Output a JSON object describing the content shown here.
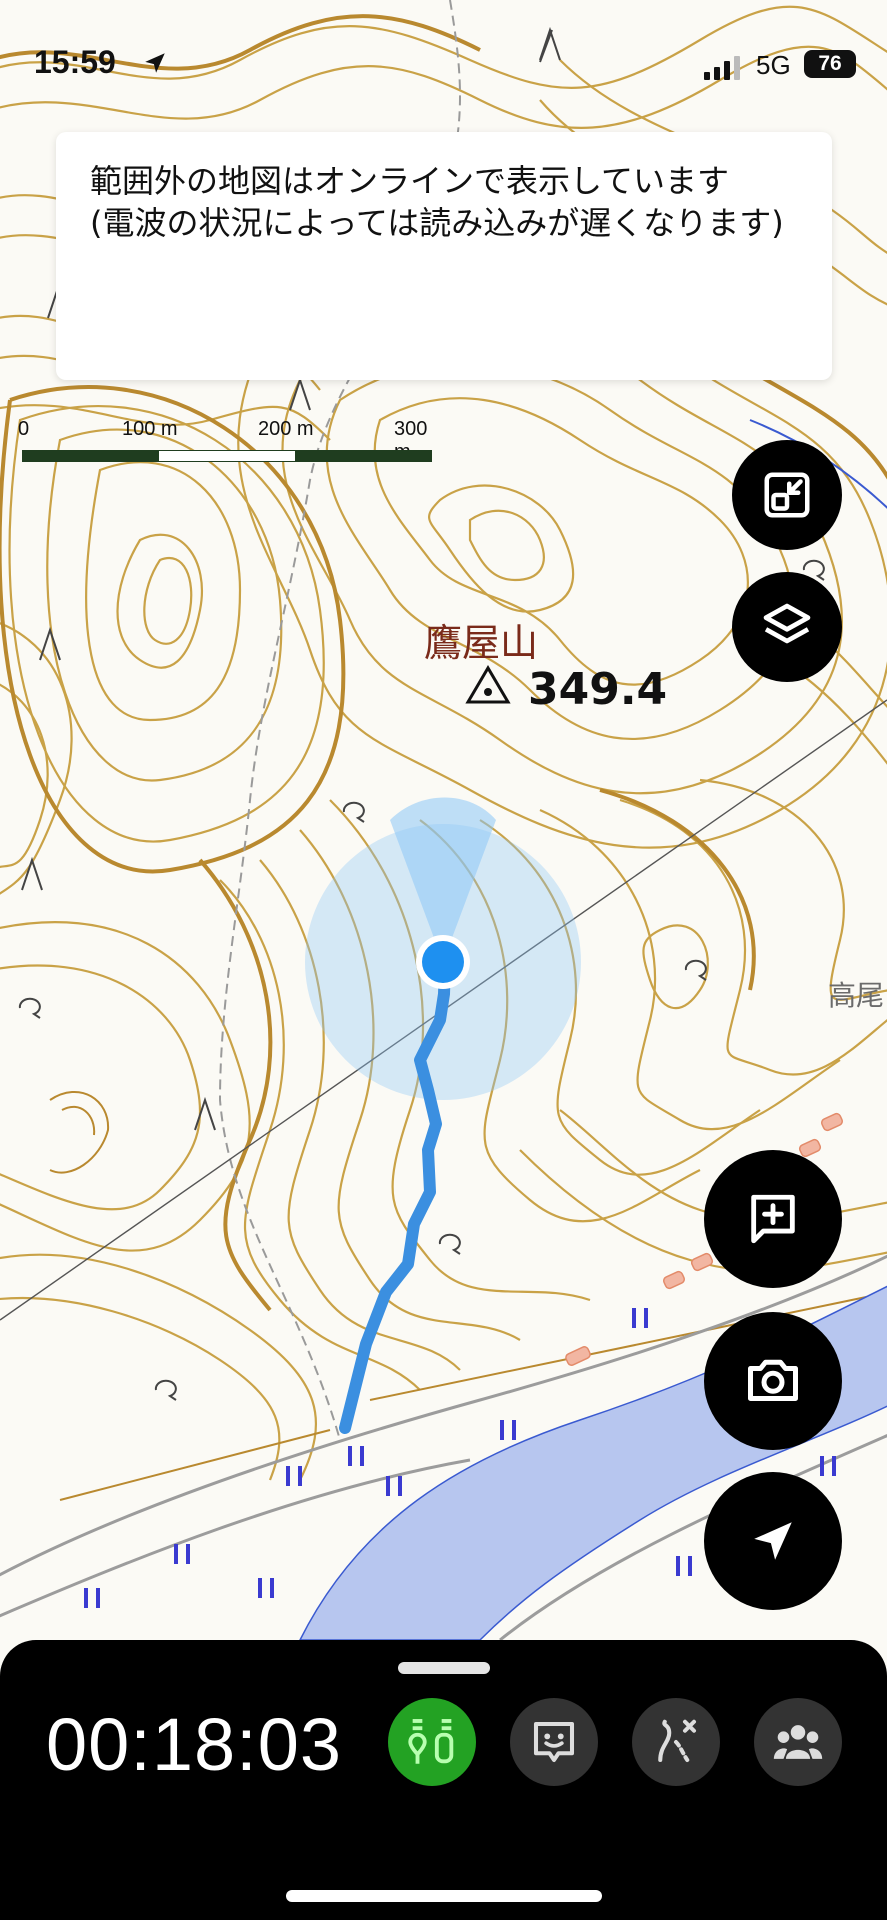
{
  "status_bar": {
    "time": "15:59",
    "network": "5G",
    "battery": "76"
  },
  "banner": {
    "message": "範囲外の地図はオンラインで表示しています\n(電波の状況によっては読み込みが遅くなります)"
  },
  "scale_bar": {
    "labels": [
      "0",
      "100 m",
      "200 m",
      "300 m"
    ]
  },
  "map": {
    "peak_name": "鷹屋山",
    "peak_elevation": "349.4",
    "place_label": "高尾",
    "colors": {
      "contour": "#c9a247",
      "river": "#b7c6ef",
      "track": "#3b8fe0",
      "location": "#1e90f0"
    }
  },
  "map_controls": [
    {
      "name": "fullscreen-button",
      "icon": "fullscreen-exit-icon"
    },
    {
      "name": "layers-button",
      "icon": "layers-icon"
    },
    {
      "name": "add-memo-button",
      "icon": "add-comment-icon"
    },
    {
      "name": "camera-button",
      "icon": "camera-icon"
    },
    {
      "name": "current-location-button",
      "icon": "navigation-arrow-icon"
    }
  ],
  "bottom_panel": {
    "elapsed_time": "00:18:03",
    "tools": [
      {
        "name": "checkpoint-tool",
        "icon": "route-pins-icon",
        "active": true,
        "color": "#3fcf3f"
      },
      {
        "name": "face-tool",
        "icon": "face-message-icon",
        "active": false
      },
      {
        "name": "route-tool",
        "icon": "route-off-icon",
        "active": false
      },
      {
        "name": "group-tool",
        "icon": "group-icon",
        "active": false
      }
    ]
  }
}
